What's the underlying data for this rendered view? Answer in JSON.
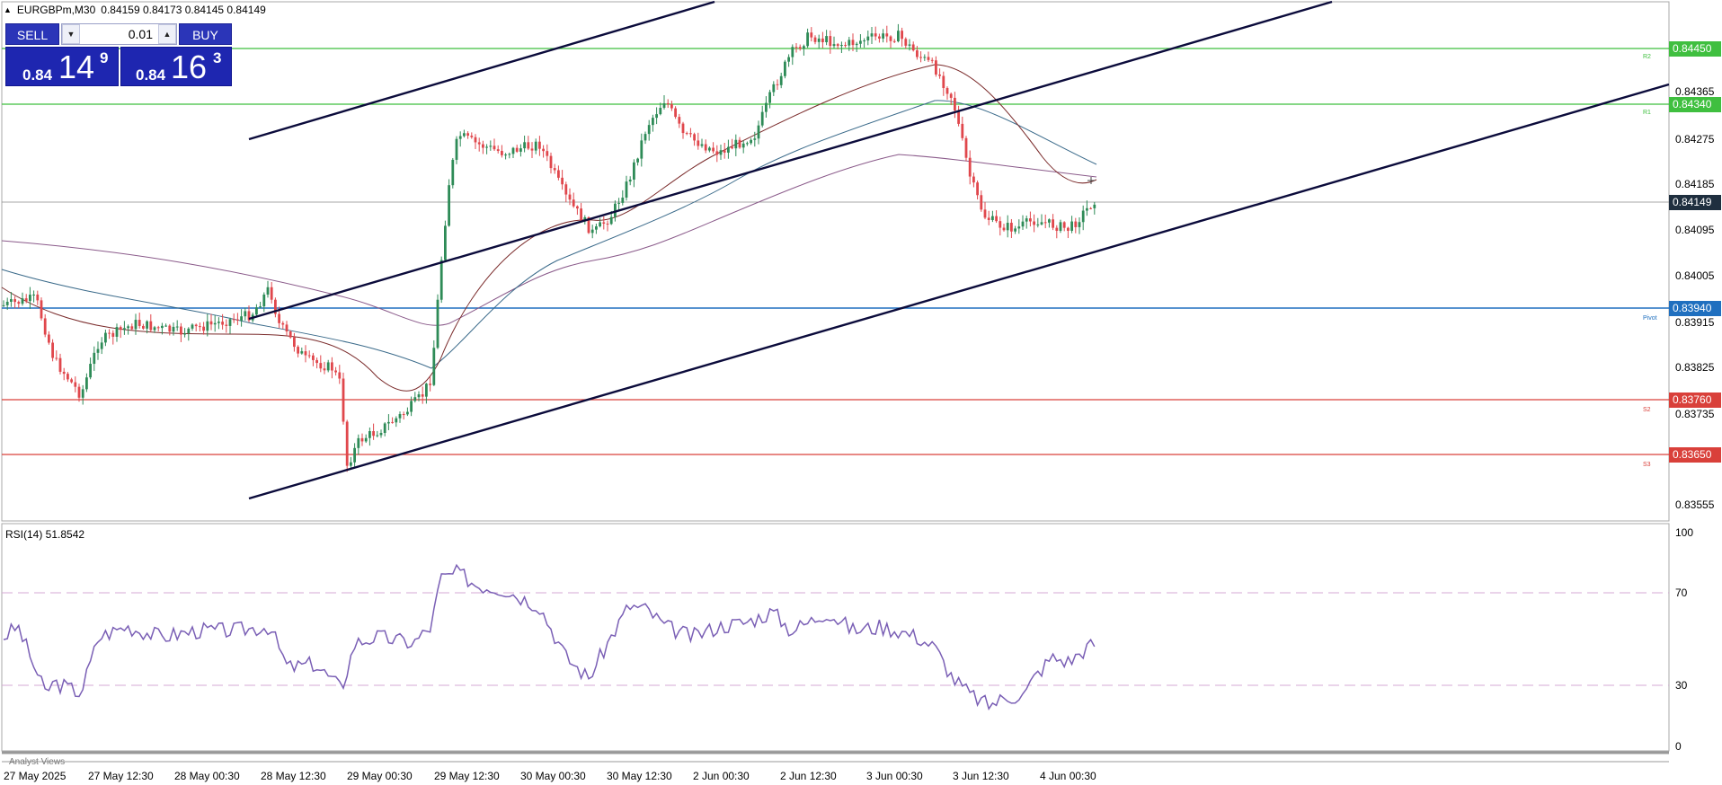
{
  "header": {
    "symbol": "EURGBPm,M30",
    "ohlc": "0.84159 0.84173 0.84145 0.84149"
  },
  "trade_panel": {
    "sell_label": "SELL",
    "buy_label": "BUY",
    "lot": "0.01",
    "sell_small": "0.84",
    "sell_big": "14",
    "sell_sup": "9",
    "buy_small": "0.84",
    "buy_big": "16",
    "buy_sup": "3"
  },
  "price_axis": [
    "0.84365",
    "0.84275",
    "0.84185",
    "0.84095",
    "0.84005",
    "0.83915",
    "0.83825",
    "0.83735",
    "0.83555"
  ],
  "price_tags": {
    "r2": "0.84450",
    "r1": "0.84340",
    "current": "0.84149",
    "pivot": "0.83940",
    "s2": "0.83760",
    "s3": "0.83650"
  },
  "level_labels": {
    "r2": "R2",
    "r1": "R1",
    "pivot": "Pivot",
    "s2": "S2",
    "s3": "S3"
  },
  "rsi": {
    "label": "RSI(14) 51.8542",
    "axis": [
      "100",
      "70",
      "30",
      "0"
    ]
  },
  "dates": [
    "27 May 2025",
    "27 May 12:30",
    "28 May 00:30",
    "28 May 12:30",
    "29 May 00:30",
    "29 May 12:30",
    "30 May 00:30",
    "30 May 12:30",
    "2 Jun 00:30",
    "2 Jun 12:30",
    "3 Jun 00:30",
    "3 Jun 12:30",
    "4 Jun 00:30"
  ],
  "analyst_views": "Analyst Views",
  "colors": {
    "up_candle": "#2e8b57",
    "down_candle": "#e0474c",
    "channel": "#0b0b3b",
    "resistance": "#3fbf3f",
    "pivot": "#1f6fbf",
    "support": "#d9403a",
    "rsi_line": "#7a5fb5"
  },
  "chart_data": [
    {
      "type": "line",
      "title": "EURGBPm,M30",
      "ylim": [
        0.8352,
        0.8458
      ],
      "series": [
        {
          "name": "R2",
          "values": [
            0.8445
          ]
        },
        {
          "name": "R1",
          "values": [
            0.8434
          ]
        },
        {
          "name": "Pivot",
          "values": [
            0.8394
          ]
        },
        {
          "name": "S2",
          "values": [
            0.8376
          ]
        },
        {
          "name": "S3",
          "values": [
            0.8365
          ]
        }
      ],
      "x": [
        "27 May 2025",
        "27 May 12:30",
        "28 May 00:30",
        "28 May 12:30",
        "29 May 00:30",
        "29 May 12:30",
        "30 May 00:30",
        "30 May 12:30",
        "2 Jun 00:30",
        "2 Jun 12:30",
        "3 Jun 00:30",
        "3 Jun 12:30",
        "4 Jun 00:30"
      ],
      "close": [
        0.8394,
        0.8389,
        0.839,
        0.8393,
        0.8369,
        0.8426,
        0.8414,
        0.8431,
        0.8426,
        0.8446,
        0.8443,
        0.8411,
        0.8415
      ],
      "last": 0.84149
    },
    {
      "type": "line",
      "title": "RSI(14) 51.8542",
      "ylim": [
        0,
        100
      ],
      "levels": [
        70,
        30
      ],
      "x": [
        "27 May 2025",
        "27 May 12:30",
        "28 May 00:30",
        "28 May 12:30",
        "29 May 00:30",
        "29 May 12:30",
        "30 May 00:30",
        "30 May 12:30",
        "2 Jun 00:30",
        "2 Jun 12:30",
        "3 Jun 00:30",
        "3 Jun 12:30",
        "4 Jun 00:30"
      ],
      "values": [
        50,
        58,
        54,
        56,
        42,
        80,
        45,
        66,
        56,
        62,
        48,
        24,
        52
      ],
      "last": 51.8542
    }
  ]
}
